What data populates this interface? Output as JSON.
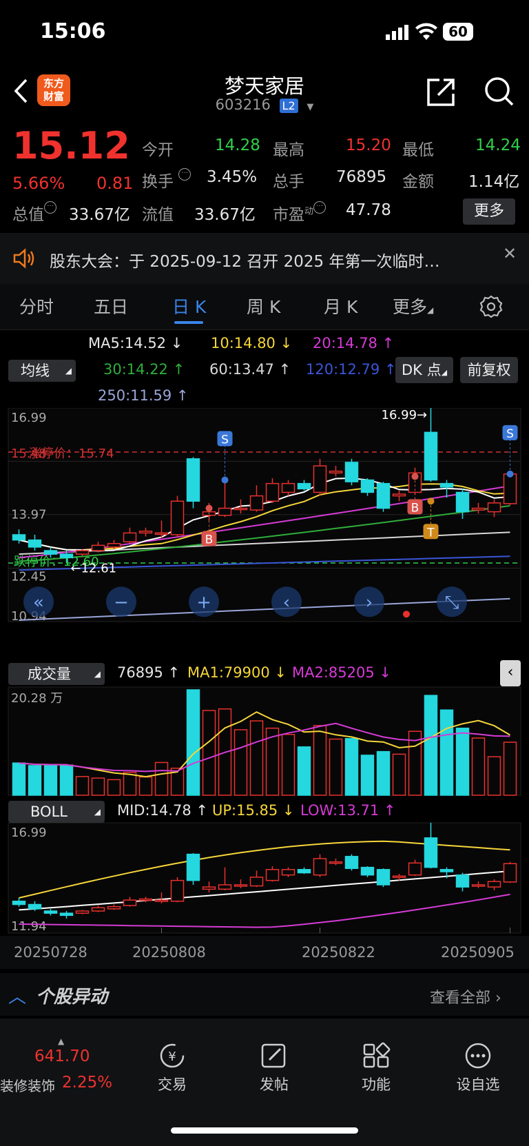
{
  "status_bar": {
    "time": "15:06",
    "battery": "60"
  },
  "header": {
    "title": "梦天家居",
    "code": "603216",
    "level_badge": "L2",
    "app_logo": "东方\n财富"
  },
  "quote": {
    "price": "15.12",
    "change_pct": "5.66%",
    "change": "0.81",
    "fields": {
      "open_label": "今开",
      "open": "14.28",
      "high_label": "最高",
      "high": "15.20",
      "low_label": "最低",
      "low": "14.24",
      "turnover_label": "换手",
      "turnover": "3.45%",
      "volume_label": "总手",
      "volume": "76895",
      "amount_label": "金额",
      "amount": "1.14亿",
      "total_mv_label": "总值",
      "total_mv": "33.67亿",
      "float_mv_label": "流值",
      "float_mv": "33.67亿",
      "pe_label": "市盈",
      "pe_sup": "动",
      "pe": "47.78"
    },
    "more_button": "更多"
  },
  "notice": {
    "text": "股东大会：于 2025-09-12 召开 2025 年第一次临时…"
  },
  "tabs": [
    {
      "label": "分时"
    },
    {
      "label": "五日"
    },
    {
      "label": "日 K"
    },
    {
      "label": "周 K"
    },
    {
      "label": "月 K"
    },
    {
      "label": "更多"
    }
  ],
  "ma_panel": {
    "selector": "均线",
    "ma5": "MA5:14.52 ↓",
    "ma10": "10:14.80 ↓",
    "ma20": "20:14.78 ↑",
    "ma30": "30:14.22 ↑",
    "ma60": "60:13.47 ↑",
    "ma120": "120:12.79 ↑",
    "ma250": "250:11.59 ↑",
    "dk_button": "DK 点",
    "adjust_button": "前复权",
    "colors": {
      "ma5": "#ffffff",
      "ma10": "#f5d63a",
      "ma20": "#d63bd6",
      "ma30": "#2fae3a",
      "ma60": "#d8d8d8",
      "ma120": "#3a56d8",
      "ma250": "#9aa6d8"
    }
  },
  "kline": {
    "axis_top": "16.99",
    "axis_mid": "13.97",
    "axis_low": "12.45",
    "axis_bottom": "10.94",
    "limit_up_line": "涨停价：15.74",
    "limit_up_value": "15.48",
    "limit_down_line": "跌停价：12.60",
    "max_label": "16.99→",
    "min_label": "←12.61",
    "markers": [
      "S",
      "B",
      "S",
      "B",
      "T"
    ]
  },
  "volume_panel": {
    "selector": "成交量",
    "value": "76895 ↑",
    "ma1": "MA1:79900 ↓",
    "ma2": "MA2:85205 ↓",
    "axis_top": "20.28 万"
  },
  "boll_panel": {
    "selector": "BOLL",
    "mid": "MID:14.78 ↑",
    "up": "UP:15.85 ↓",
    "low": "LOW:13.71 ↑",
    "axis_top": "16.99",
    "axis_bottom": "11.94"
  },
  "dates": [
    "20250728",
    "20250808",
    "20250822",
    "20250905"
  ],
  "chart_data": {
    "type": "candlestick",
    "candles": [
      {
        "o": 13.4,
        "c": 13.25,
        "h": 13.55,
        "l": 13.15
      },
      {
        "o": 13.25,
        "c": 13.05,
        "h": 13.4,
        "l": 12.95
      },
      {
        "o": 12.95,
        "c": 12.85,
        "h": 13.05,
        "l": 12.75
      },
      {
        "o": 12.85,
        "c": 12.75,
        "h": 12.95,
        "l": 12.61
      },
      {
        "o": 12.85,
        "c": 12.95,
        "h": 13.0,
        "l": 12.8
      },
      {
        "o": 12.95,
        "c": 13.1,
        "h": 13.2,
        "l": 12.9
      },
      {
        "o": 13.05,
        "c": 13.15,
        "h": 13.25,
        "l": 13.0
      },
      {
        "o": 13.2,
        "c": 13.45,
        "h": 13.6,
        "l": 13.15
      },
      {
        "o": 13.45,
        "c": 13.5,
        "h": 13.6,
        "l": 13.35
      },
      {
        "o": 13.45,
        "c": 13.45,
        "h": 13.8,
        "l": 13.3
      },
      {
        "o": 13.4,
        "c": 14.35,
        "h": 14.5,
        "l": 13.35
      },
      {
        "o": 15.55,
        "c": 14.35,
        "h": 15.6,
        "l": 14.15
      },
      {
        "o": 13.95,
        "c": 14.05,
        "h": 14.3,
        "l": 13.8
      },
      {
        "o": 13.95,
        "c": 14.15,
        "h": 14.95,
        "l": 13.9
      },
      {
        "o": 14.15,
        "c": 14.15,
        "h": 14.4,
        "l": 14.0
      },
      {
        "o": 14.1,
        "c": 14.5,
        "h": 14.8,
        "l": 14.05
      },
      {
        "o": 14.35,
        "c": 14.85,
        "h": 15.0,
        "l": 14.3
      },
      {
        "o": 14.6,
        "c": 14.85,
        "h": 14.95,
        "l": 14.5
      },
      {
        "o": 14.85,
        "c": 14.7,
        "h": 14.95,
        "l": 14.65
      },
      {
        "o": 14.6,
        "c": 15.35,
        "h": 15.55,
        "l": 14.5
      },
      {
        "o": 15.15,
        "c": 15.2,
        "h": 15.35,
        "l": 15.05
      },
      {
        "o": 15.45,
        "c": 14.9,
        "h": 15.55,
        "l": 14.8
      },
      {
        "o": 14.95,
        "c": 14.6,
        "h": 15.0,
        "l": 14.5
      },
      {
        "o": 14.85,
        "c": 14.15,
        "h": 14.9,
        "l": 14.05
      },
      {
        "o": 14.5,
        "c": 14.55,
        "h": 14.65,
        "l": 14.35
      },
      {
        "o": 14.6,
        "c": 15.15,
        "h": 15.3,
        "l": 14.55
      },
      {
        "o": 16.3,
        "c": 14.95,
        "h": 16.99,
        "l": 14.9
      },
      {
        "o": 14.85,
        "c": 14.75,
        "h": 14.95,
        "l": 14.45
      },
      {
        "o": 14.6,
        "c": 14.05,
        "h": 14.7,
        "l": 13.85
      },
      {
        "o": 14.1,
        "c": 14.15,
        "h": 14.3,
        "l": 14.0
      },
      {
        "o": 14.05,
        "c": 14.3,
        "h": 14.4,
        "l": 13.9
      },
      {
        "o": 14.28,
        "c": 15.12,
        "h": 15.2,
        "l": 14.24
      }
    ],
    "volume": [
      6.2,
      5.7,
      5.8,
      5.8,
      3.6,
      3.3,
      3.0,
      4.4,
      3.5,
      6.3,
      5.2,
      20.28,
      16.3,
      16.6,
      12.6,
      14.3,
      12.9,
      11.7,
      9.3,
      13.4,
      10.8,
      10.9,
      7.7,
      8.4,
      7.9,
      12.3,
      19.2,
      16.4,
      12.9,
      11.0,
      7.4,
      10.2
    ],
    "ymax": 16.99,
    "ymin": 10.94
  }
}
